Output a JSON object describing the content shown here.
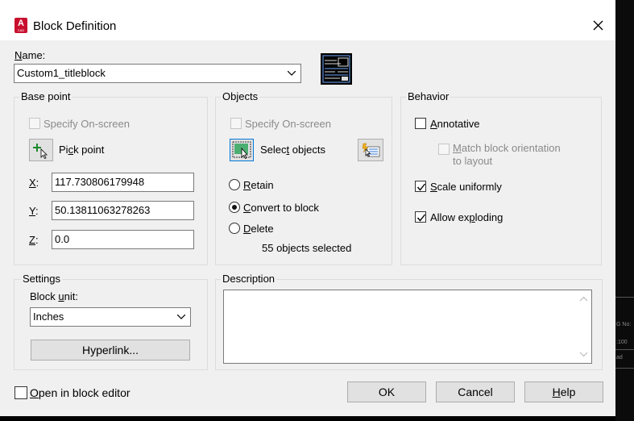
{
  "window": {
    "title": "Block Definition",
    "app_icon_letter": "A",
    "app_icon_sub": "CAD"
  },
  "name": {
    "label_u": "N",
    "label_rest": "ame:",
    "value": "Custom1_titleblock"
  },
  "base_point": {
    "title": "Base point",
    "specify_on_screen": "Specify On-screen",
    "pick_point_pre": "Pi",
    "pick_point_u": "c",
    "pick_point_post": "k point",
    "x_label": "X",
    "x_value": "117.730806179948",
    "y_label": "Y",
    "y_value": "50.13811063278263",
    "z_label": "Z",
    "z_value": "0.0"
  },
  "objects": {
    "title": "Objects",
    "specify_on_screen": "Specify On-screen",
    "select_pre": "Selec",
    "select_u": "t",
    "select_post": " objects",
    "retain_u": "R",
    "retain_rest": "etain",
    "convert_u": "C",
    "convert_rest": "onvert to block",
    "delete_u": "D",
    "delete_rest": "elete",
    "count_text": "55 objects selected",
    "selected_option": "convert"
  },
  "behavior": {
    "title": "Behavior",
    "annotative_u": "A",
    "annotative_rest": "nnotative",
    "annotative_checked": false,
    "match_u": "M",
    "match_line1_rest": "atch block orientation",
    "match_line2": "to layout",
    "scale_u": "S",
    "scale_rest": "cale uniformly",
    "scale_checked": true,
    "explode_pre": "Allow ex",
    "explode_u": "p",
    "explode_post": "loding",
    "explode_checked": true
  },
  "settings": {
    "title": "Settings",
    "block_unit_pre": "Block ",
    "block_unit_u": "u",
    "block_unit_post": "nit:",
    "unit_value": "Inches",
    "hyperlink": "Hyperlink..."
  },
  "description": {
    "title": "Description",
    "value": ""
  },
  "footer": {
    "open_editor_u": "O",
    "open_editor_rest": "pen in block editor",
    "open_editor_checked": false,
    "ok": "OK",
    "cancel": "Cancel",
    "help_u": "H",
    "help_rest": "elp"
  },
  "background": {
    "text1": "G No:",
    "text2": ":100",
    "text3": "ad"
  },
  "colors": {
    "accent_red": "#c8102e",
    "select_green": "#2e8b57"
  }
}
